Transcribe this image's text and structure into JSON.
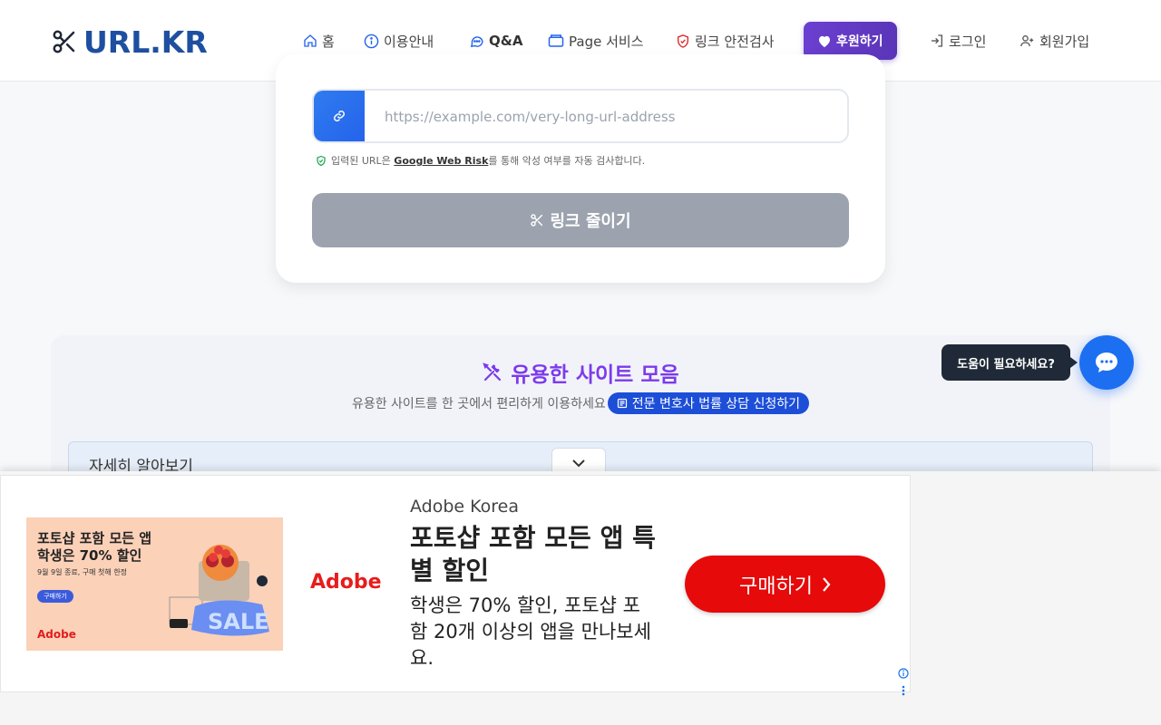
{
  "header": {
    "logo_text": "URL.KR",
    "nav": [
      {
        "label": "홈",
        "icon": "home-icon"
      },
      {
        "label": "이용안내",
        "icon": "info-icon"
      },
      {
        "label": "Q&A",
        "icon": "chat-icon"
      },
      {
        "label": "Page 서비스",
        "icon": "folder-icon"
      },
      {
        "label": "링크 안전검사",
        "icon": "shield-icon"
      },
      {
        "label": "후원하기",
        "icon": "heart-icon"
      },
      {
        "label": "로그인",
        "icon": "login-icon"
      },
      {
        "label": "회원가입",
        "icon": "user-plus-icon"
      }
    ]
  },
  "shortener": {
    "url_placeholder": "https://example.com/very-long-url-address",
    "url_value": "",
    "note_prefix": "입력된 URL은 ",
    "note_highlight": "Google Web Risk",
    "note_suffix": "를 통해 악성 여부를 자동 검사합니다.",
    "button_label": "링크 줄이기"
  },
  "useful_sites": {
    "title": "유용한 사이트 모음",
    "subtitle": "유용한 사이트를 한 곳에서 편리하게 이용하세요",
    "lawyer_badge": "전문 변호사 법률 상담 신청하기",
    "detail_label": "자세히 알아보기"
  },
  "help": {
    "tooltip": "도움이 필요하세요?"
  },
  "ad": {
    "image_title_line1": "포토샵 포함 모든 앱",
    "image_title_line2": "학생은 70% 할인",
    "image_sub": "9월 9일 종료, 구매 첫해 한정",
    "image_button": "구매하기",
    "image_brand": "Adobe",
    "brand_logo": "Adobe",
    "advertiser": "Adobe Korea",
    "headline": "포토샵 포함 모든 앱 특별 할인",
    "body": "학생은 70% 할인, 포토샵 포함 20개 이상의 앱을 만나보세요.",
    "cta": "구매하기",
    "colors": {
      "brand": "#e81c1c",
      "cta": "#e60a0a"
    }
  },
  "colors": {
    "accent_blue": "#2563eb",
    "accent_purple": "#7c3aed",
    "disabled_button": "#9ca3af"
  }
}
